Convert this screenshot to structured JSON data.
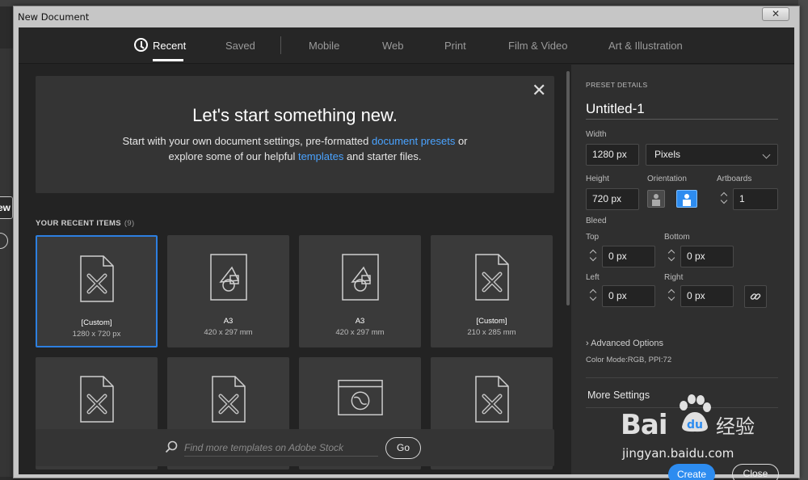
{
  "window": {
    "title": "New Document",
    "close_glyph": "✕"
  },
  "background": {
    "partial_button_text": "ew"
  },
  "tabs": [
    {
      "label": "Recent"
    },
    {
      "label": "Saved"
    },
    {
      "label": "Mobile"
    },
    {
      "label": "Web"
    },
    {
      "label": "Print"
    },
    {
      "label": "Film & Video"
    },
    {
      "label": "Art & Illustration"
    }
  ],
  "hero": {
    "title": "Let's start something new.",
    "line1_a": "Start with your own document settings, pre-formatted ",
    "line1_link": "document presets",
    "line1_b": " or",
    "line2_a": "explore some of our helpful ",
    "line2_link": "templates",
    "line2_b": " and starter files.",
    "close_glyph": "✕"
  },
  "recent": {
    "label": "YOUR RECENT ITEMS",
    "count": "(9)",
    "items": [
      {
        "name": "[Custom]",
        "size": "1280 x 720 px",
        "icon": "custom-doc-icon"
      },
      {
        "name": "A3",
        "size": "420 x 297 mm",
        "icon": "shapes-doc-icon"
      },
      {
        "name": "A3",
        "size": "420 x 297 mm",
        "icon": "shapes-doc-icon"
      },
      {
        "name": "[Custom]",
        "size": "210 x 285 mm",
        "icon": "custom-doc-icon"
      },
      {
        "icon": "custom-doc-icon"
      },
      {
        "icon": "custom-doc-icon"
      },
      {
        "icon": "web-doc-icon"
      },
      {
        "icon": "custom-doc-icon"
      }
    ]
  },
  "search": {
    "placeholder": "Find more templates on Adobe Stock",
    "go_label": "Go"
  },
  "preset": {
    "section_label": "PRESET DETAILS",
    "doc_name": "Untitled-1",
    "width_label": "Width",
    "width_value": "1280 px",
    "units_value": "Pixels",
    "height_label": "Height",
    "height_value": "720 px",
    "orientation_label": "Orientation",
    "artboards_label": "Artboards",
    "artboards_value": "1",
    "bleed_label": "Bleed",
    "top_label": "Top",
    "top_value": "0 px",
    "bottom_label": "Bottom",
    "bottom_value": "0 px",
    "left_label": "Left",
    "left_value": "0 px",
    "right_label": "Right",
    "right_value": "0 px",
    "advanced_label": "Advanced Options",
    "color_mode": "Color Mode:RGB, PPI:72",
    "more_settings": "More Settings",
    "create_label": "Create",
    "close_label": "Close"
  },
  "watermark": {
    "brand": "Bai",
    "brand_suffix": "du",
    "chinese": "经验",
    "url": "jingyan.baidu.com"
  },
  "colors": {
    "accent": "#2d8cf0",
    "link": "#4aa3ff",
    "panel": "#2f2f2f",
    "card": "#3a3a3a"
  }
}
